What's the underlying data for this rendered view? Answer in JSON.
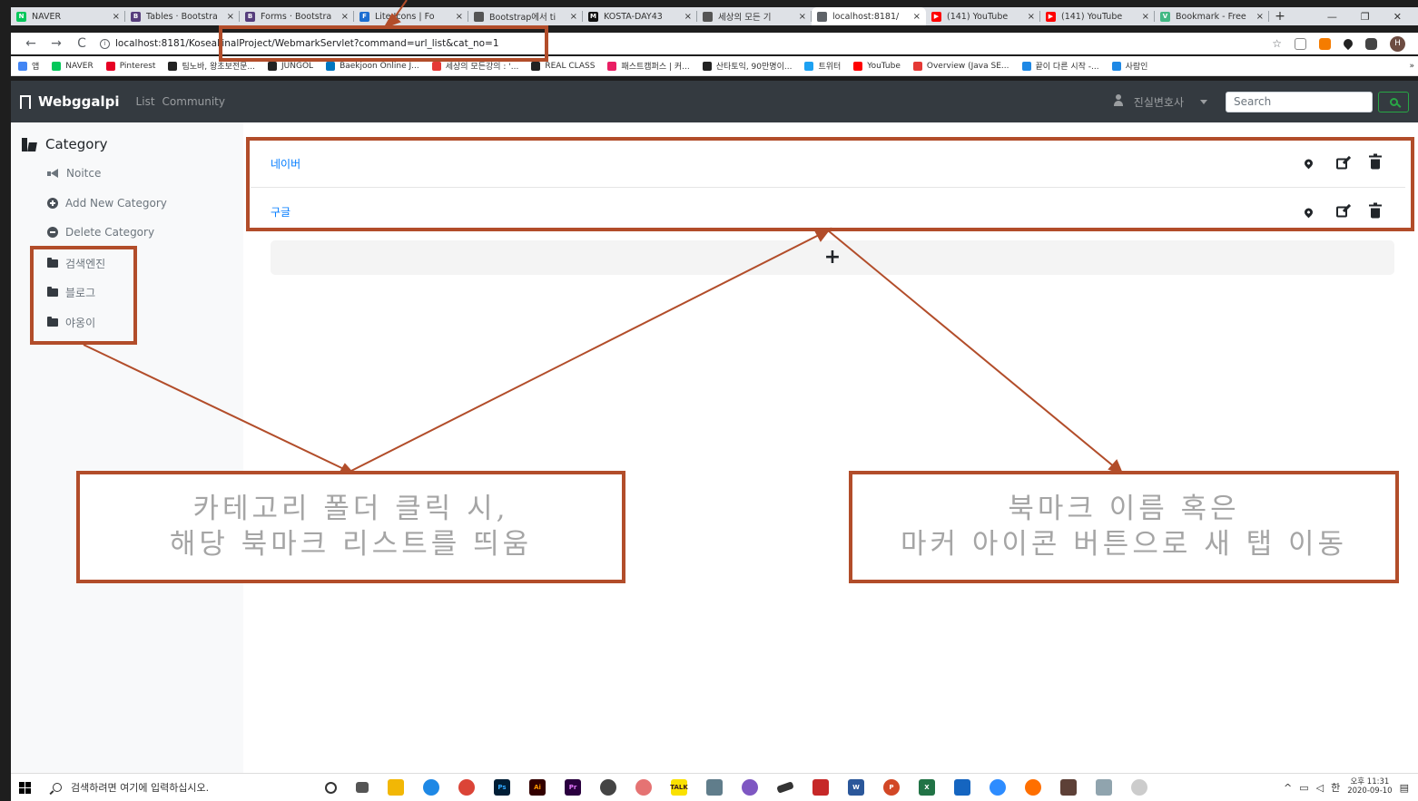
{
  "browser": {
    "tabs": [
      {
        "title": "NAVER",
        "fav_color": "#03c75a",
        "fav_text": "N",
        "active": false
      },
      {
        "title": "Tables · Bootstra",
        "fav_color": "#563d7c",
        "fav_text": "B",
        "active": false
      },
      {
        "title": "Forms · Bootstra",
        "fav_color": "#563d7c",
        "fav_text": "B",
        "active": false
      },
      {
        "title": "Lite Icons | Fo",
        "fav_color": "#1c6ed1",
        "fav_text": "F",
        "active": false
      },
      {
        "title": "Bootstrap에서 ti",
        "fav_color": "#555555",
        "fav_text": "",
        "active": false
      },
      {
        "title": "KOSTA-DAY43",
        "fav_color": "#111111",
        "fav_text": "M",
        "active": false
      },
      {
        "title": "세상의 모든 기",
        "fav_color": "#555555",
        "fav_text": "",
        "active": false
      },
      {
        "title": "localhost:8181/",
        "fav_color": "#5f6368",
        "fav_text": "",
        "active": true
      },
      {
        "title": "(141) YouTube",
        "fav_color": "#ff0000",
        "fav_text": "▶",
        "active": false
      },
      {
        "title": "(141) YouTube",
        "fav_color": "#ff0000",
        "fav_text": "▶",
        "active": false
      },
      {
        "title": "Bookmark - Free",
        "fav_color": "#41b883",
        "fav_text": "V",
        "active": false
      }
    ],
    "close_glyph": "×",
    "new_tab": "+",
    "window_controls": [
      "—",
      "❐",
      "✕"
    ],
    "nav": {
      "back": "←",
      "forward": "→",
      "reload": "C"
    },
    "url": "localhost:8181/KoseaFinalProject/WebmarkServlet?command=url_list&cat_no=1",
    "star": "☆",
    "bookmarks_bar": [
      {
        "label": "앱",
        "color": "#4285f4"
      },
      {
        "label": "NAVER",
        "color": "#03c75a"
      },
      {
        "label": "Pinterest",
        "color": "#e60023"
      },
      {
        "label": "팀노바, 왕초보전문...",
        "color": "#222222"
      },
      {
        "label": "JUNGOL",
        "color": "#222222"
      },
      {
        "label": "Baekjoon Online J...",
        "color": "#0076c0"
      },
      {
        "label": "세상의 모든강의 : '...",
        "color": "#e53935"
      },
      {
        "label": "REAL CLASS",
        "color": "#222222"
      },
      {
        "label": "패스트캠퍼스 | 커...",
        "color": "#e91e63"
      },
      {
        "label": "산타토익, 90만명이...",
        "color": "#222222"
      },
      {
        "label": "트위터",
        "color": "#1da1f2"
      },
      {
        "label": "YouTube",
        "color": "#ff0000"
      },
      {
        "label": "Overview (Java SE...",
        "color": "#e53935"
      },
      {
        "label": "끝이 다른 시작 -...",
        "color": "#1e88e5"
      },
      {
        "label": "사람인",
        "color": "#1e88e5"
      }
    ],
    "more": "»"
  },
  "navbar": {
    "brand": "Webggalpi",
    "links": [
      "List",
      "Community"
    ],
    "user": "진실변호사",
    "search_placeholder": "Search"
  },
  "sidebar": {
    "title": "Category",
    "actions": [
      {
        "label": "Noitce",
        "icon": "bullhorn-icon"
      },
      {
        "label": "Add New Category",
        "icon": "plus-circle-icon"
      },
      {
        "label": "Delete Category",
        "icon": "minus-circle-icon"
      }
    ],
    "folders": [
      "검색엔진",
      "블로그",
      "야옹이"
    ]
  },
  "bookmarks": [
    {
      "name": "네이버"
    },
    {
      "name": "구글"
    }
  ],
  "add_label": "+",
  "annotations": {
    "left": [
      "카테고리 폴더 클릭 시,",
      "해당 북마크 리스트를 띄움"
    ],
    "right": [
      "북마크 이름 혹은",
      "마커 아이콘 버튼으로 새 탭 이동"
    ],
    "color": "#b24d2a"
  },
  "taskbar": {
    "search_placeholder": "검색하려면 여기에 입력하십시오.",
    "tray_lang": "한",
    "time": "오후 11:31",
    "date": "2020-09-10"
  }
}
